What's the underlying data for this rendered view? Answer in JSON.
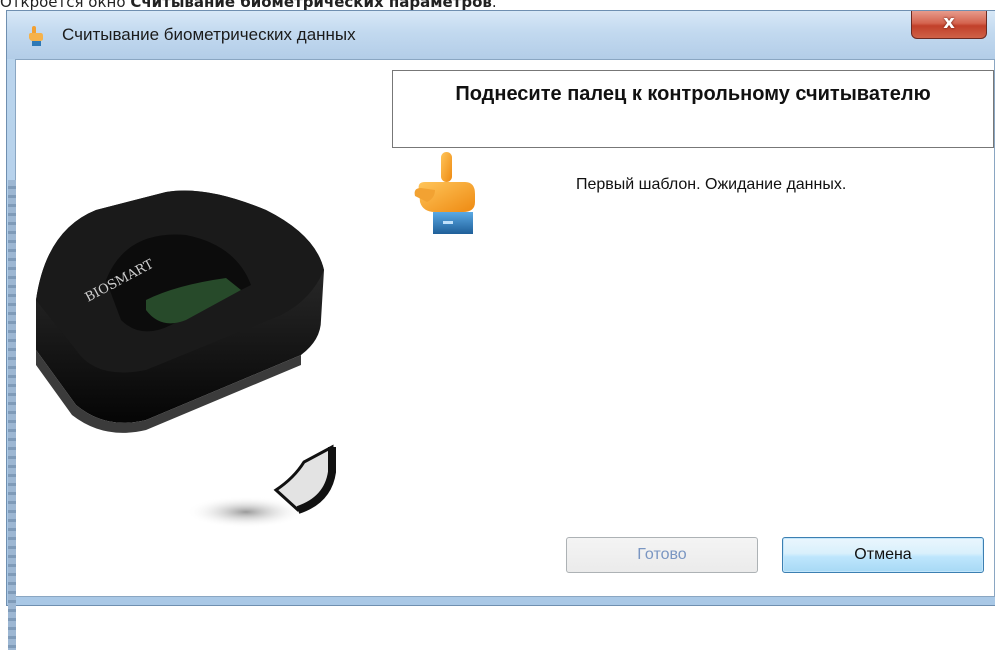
{
  "doc": {
    "prefix": "Откроется окно ",
    "bold": "Считывание биометрических параметров",
    "suffix": "."
  },
  "window": {
    "title": "Считывание биометрических данных",
    "close_label": "x",
    "title_icon": "hand-pointer-icon"
  },
  "dialog": {
    "instruction": "Поднесите палец к контрольному считывателю",
    "status": "Первый шаблон. Ожидание данных.",
    "scanner_brand": "BIOSMART",
    "illustration_icon": "fingerprint-scanner-icon",
    "hand_icon": "hand-pointer-icon"
  },
  "buttons": {
    "done": "Готово",
    "cancel": "Отмена"
  },
  "colors": {
    "accent": "#3c7fb1",
    "close": "#c1402a",
    "hand": "#f5a623"
  }
}
